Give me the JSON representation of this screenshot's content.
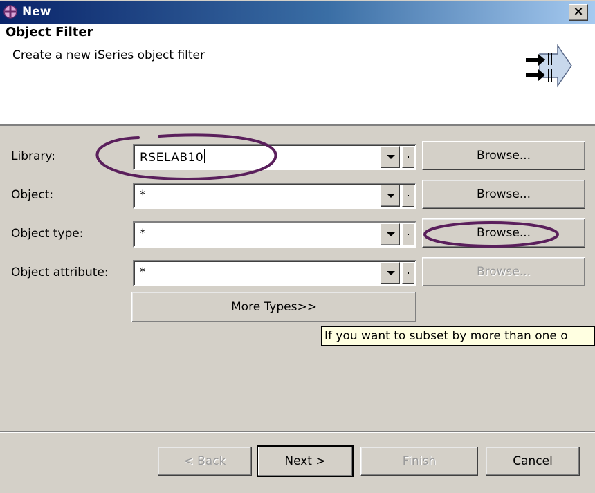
{
  "window": {
    "title": "New",
    "title_icon": "eclipse-new-wizard-icon",
    "close_symbol": "×"
  },
  "banner": {
    "title": "Object Filter",
    "description": "Create a new iSeries object filter",
    "icon": "filter-arrows-icon"
  },
  "form": {
    "library": {
      "label": "Library:",
      "value": "RSELAB10",
      "browse_label": "Browse..."
    },
    "object": {
      "label": "Object:",
      "value": "*",
      "browse_label": "Browse..."
    },
    "object_type": {
      "label": "Object type:",
      "value": "*",
      "browse_label": "Browse..."
    },
    "object_attribute": {
      "label": "Object attribute:",
      "value": "*",
      "browse_label": "Browse..."
    },
    "more_types_label": "More Types>>"
  },
  "tooltip": {
    "text": "If you want to subset by more than one o"
  },
  "footer": {
    "back_label": "< Back",
    "next_label": "Next >",
    "finish_label": "Finish",
    "cancel_label": "Cancel"
  },
  "colors": {
    "titlebar_start": "#0a246a",
    "titlebar_end": "#a6caf0",
    "dialog_bg": "#d4d0c8",
    "annotation": "#5a1f5c",
    "tooltip_bg": "#ffffe1"
  }
}
